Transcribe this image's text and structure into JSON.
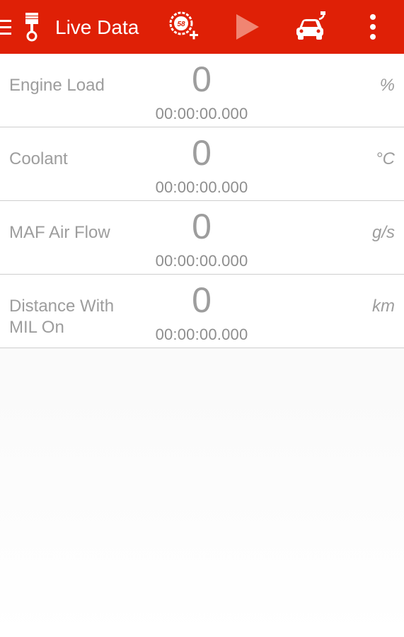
{
  "app": {
    "title": "Live Data"
  },
  "toolbar": {
    "icons": [
      "menu-icon",
      "piston-icon",
      "add-gauge-icon",
      "play-icon",
      "car-connect-icon",
      "overflow-menu-icon"
    ],
    "gauge_icon_number": "58",
    "colors": {
      "background": "#df2006",
      "play_disabled": "#f08572",
      "foreground": "#ffffff"
    }
  },
  "readings": [
    {
      "label": "Engine Load",
      "value": "0",
      "time": "00:00:00.000",
      "unit": "%"
    },
    {
      "label": "Coolant",
      "value": "0",
      "time": "00:00:00.000",
      "unit": "°C"
    },
    {
      "label": "MAF Air Flow",
      "value": "0",
      "time": "00:00:00.000",
      "unit": "g/s"
    },
    {
      "label": "Distance With MIL On",
      "value": "0",
      "time": "00:00:00.000",
      "unit": "km"
    }
  ]
}
